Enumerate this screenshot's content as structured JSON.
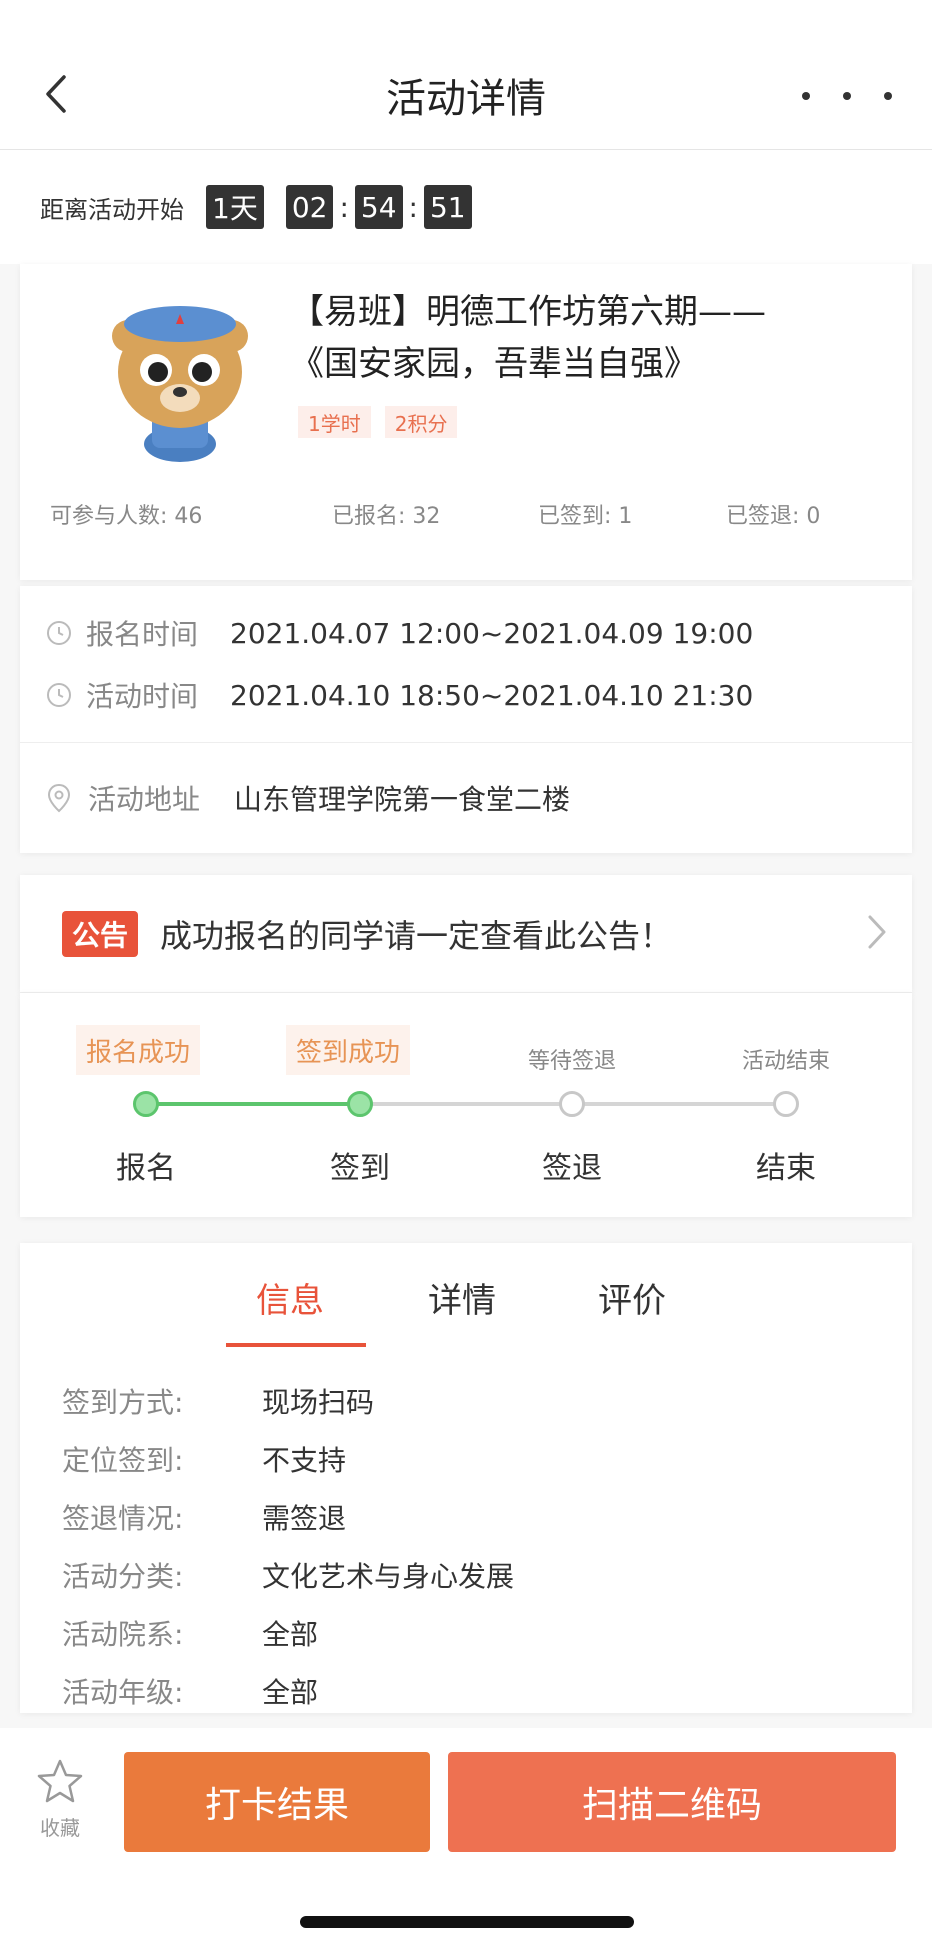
{
  "nav": {
    "title": "活动详情",
    "back_icon": "chevron-left-icon",
    "more_icon": "more-dots-icon"
  },
  "countdown": {
    "label": "距离活动开始",
    "days": "1天",
    "hours": "02",
    "minutes": "54",
    "seconds": "51",
    "sep": ":"
  },
  "activity": {
    "title_line1": "【易班】明德工作坊第六期——",
    "title_line2": "《国安家园，吾辈当自强》",
    "tags": [
      "1学时",
      "2积分"
    ],
    "stats": {
      "capacity": "可参与人数: 46",
      "registered": "已报名: 32",
      "signed_in": "已签到: 1",
      "signed_out": "已签退: 0"
    }
  },
  "times": {
    "register_label": "报名时间",
    "register_value": "2021.04.07 12:00~2021.04.09 19:00",
    "activity_label": "活动时间",
    "activity_value": "2021.04.10 18:50~2021.04.10 21:30",
    "address_label": "活动地址",
    "address_value": "山东管理学院第一食堂二楼"
  },
  "notice": {
    "badge": "公告",
    "text": "成功报名的同学请一定查看此公告！"
  },
  "progress": {
    "steps": [
      {
        "status": "报名成功",
        "label": "报名",
        "done": true
      },
      {
        "status": "签到成功",
        "label": "签到",
        "done": true
      },
      {
        "status": "等待签退",
        "label": "签退",
        "done": false
      },
      {
        "status": "活动结束",
        "label": "结束",
        "done": false
      }
    ],
    "done_color": "#5cc56d"
  },
  "tabs": [
    "信息",
    "详情",
    "评价"
  ],
  "info": [
    {
      "key": "签到方式:",
      "value": "现场扫码"
    },
    {
      "key": "定位签到:",
      "value": "不支持"
    },
    {
      "key": "签退情况:",
      "value": "需签退"
    },
    {
      "key": "活动分类:",
      "value": "文化艺术与身心发展"
    },
    {
      "key": "活动院系:",
      "value": "全部"
    },
    {
      "key": "活动年级:",
      "value": "全部"
    }
  ],
  "bottom": {
    "favorite_label": "收藏",
    "result_button": "打卡结果",
    "scan_button": "扫描二维码"
  },
  "colors": {
    "accent": "#e8533a",
    "orange_button": "#ea7a3c",
    "scan_button": "#ee7151"
  }
}
